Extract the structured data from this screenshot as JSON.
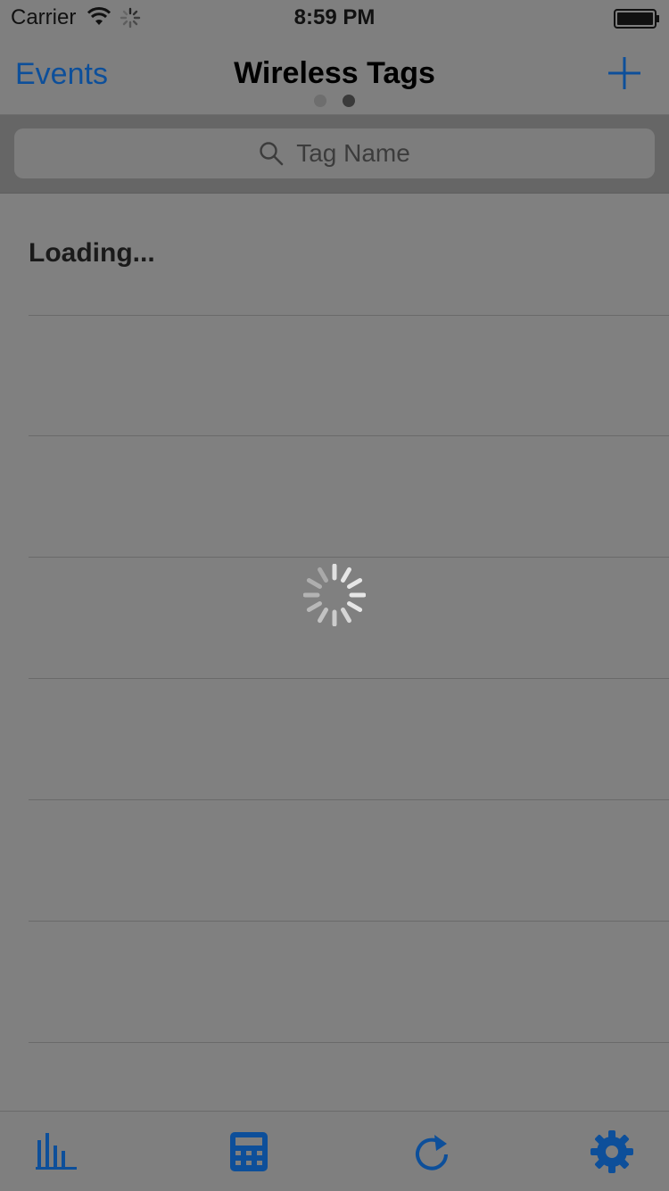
{
  "status_bar": {
    "carrier": "Carrier",
    "time": "8:59 PM",
    "icons": [
      "wifi-icon",
      "activity-spinner-icon",
      "battery-icon"
    ]
  },
  "nav": {
    "back_label": "Events",
    "title": "Wireless Tags",
    "add_icon": "plus-icon",
    "page_indicator": {
      "pages": 2,
      "current": 2
    }
  },
  "search": {
    "placeholder": "Tag Name",
    "icon": "search-icon"
  },
  "list": {
    "loading_text": "Loading..."
  },
  "tab_bar": {
    "tabs": [
      {
        "icon": "bar-chart-icon"
      },
      {
        "icon": "calculator-icon"
      },
      {
        "icon": "refresh-icon"
      },
      {
        "icon": "gear-icon"
      }
    ]
  },
  "colors": {
    "accent": "#0d4f9a",
    "overlay_background": "#808080"
  }
}
